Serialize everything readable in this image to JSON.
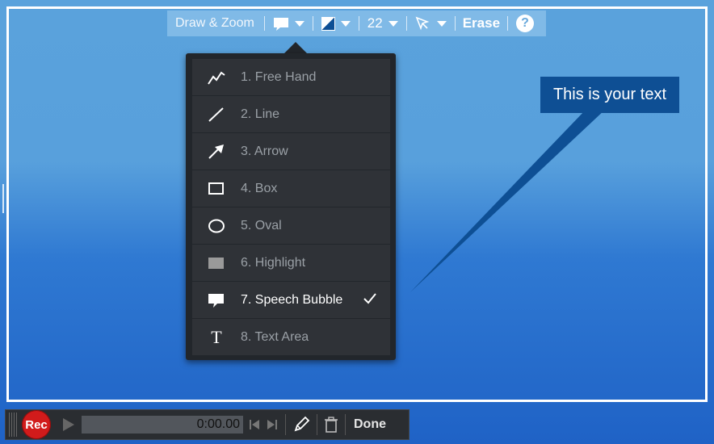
{
  "toolbar": {
    "title": "Draw & Zoom",
    "size_value": "22",
    "erase_label": "Erase",
    "help_label": "?"
  },
  "dropdown": {
    "items": [
      {
        "label": "1. Free Hand",
        "icon": "freehand-icon"
      },
      {
        "label": "2. Line",
        "icon": "line-icon"
      },
      {
        "label": "3. Arrow",
        "icon": "arrow-icon"
      },
      {
        "label": "4. Box",
        "icon": "box-icon"
      },
      {
        "label": "5. Oval",
        "icon": "oval-icon"
      },
      {
        "label": "6. Highlight",
        "icon": "highlight-icon"
      },
      {
        "label": "7. Speech Bubble",
        "icon": "speech-bubble-icon",
        "selected": true
      },
      {
        "label": "8. Text Area",
        "icon": "text-area-icon"
      }
    ],
    "text_icon_glyph": "T"
  },
  "callout": {
    "text": "This is your text"
  },
  "bottombar": {
    "rec_label": "Rec",
    "time": "0:00.00",
    "done_label": "Done"
  },
  "colors": {
    "accent": "#0e4f94",
    "rec": "#d11b1b",
    "menu_bg": "#2f3237"
  }
}
